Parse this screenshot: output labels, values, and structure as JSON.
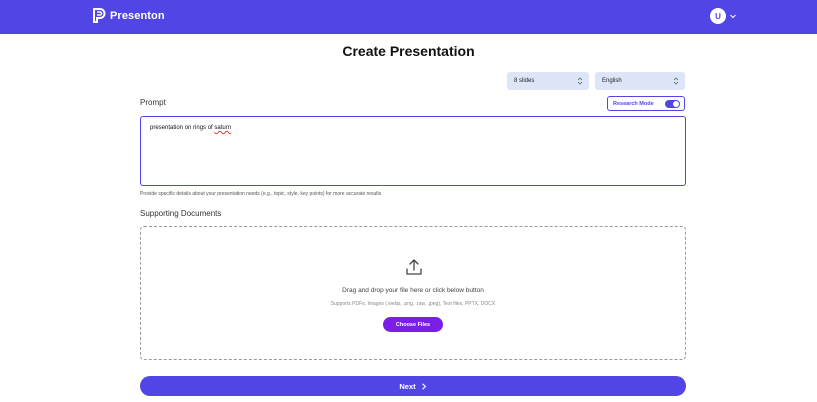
{
  "header": {
    "brand_name": "Presenton",
    "brand_icon": "presenton-logo-icon",
    "user_initial": "U",
    "user_menu_icon": "chevron-down-icon",
    "bar_color": "#5146e5"
  },
  "page": {
    "title": "Create Presentation"
  },
  "options": {
    "slides": {
      "value": "8 slides",
      "icon": "chevron-up-down-icon"
    },
    "language": {
      "value": "English",
      "icon": "chevron-up-down-icon"
    }
  },
  "prompt": {
    "label": "Prompt",
    "research_mode_label": "Research Mode",
    "research_mode_on": true,
    "value_prefix": "presentation on rings of ",
    "value_misspelled": "saturn",
    "hint": "Provide specific details about your presentation needs (e.g., topic, style, key points) for more accurate results"
  },
  "documents": {
    "label": "Supporting Documents",
    "upload_icon": "upload-icon",
    "drop_text": "Drag and drop your file here or click below button",
    "supported_text": "Supports PDFs, Images (.webp, .png, .raw, .jpeg), Text files, PPTX, DOCX",
    "choose_files_label": "Choose Files"
  },
  "footer": {
    "next_label": "Next",
    "next_icon": "chevron-right-icon"
  },
  "colors": {
    "accent": "#5146e5",
    "choose_button": "#7b1fe8",
    "select_bg": "#dce6f8"
  }
}
